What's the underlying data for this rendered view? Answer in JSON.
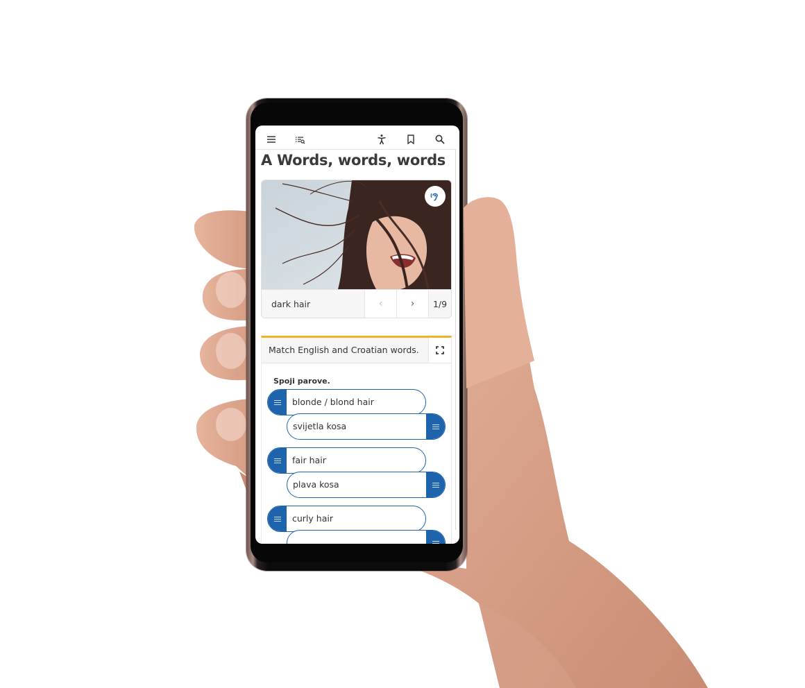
{
  "toolbar": {
    "icons": [
      "menu-icon",
      "table-of-contents-search-icon",
      "accessibility-icon",
      "bookmark-icon",
      "search-icon"
    ]
  },
  "page": {
    "title": "A Words, words, words"
  },
  "gallery": {
    "caption": "dark hair",
    "prev_label": "‹",
    "next_label": "›",
    "counter": "1/9",
    "listen_icon": "hearing-icon"
  },
  "exercise": {
    "title": "Match English and Croatian words.",
    "expand_icon": "fullscreen-icon",
    "instruction": "Spoji parove.",
    "pairs": [
      {
        "english": "blonde / blond hair",
        "croatian": "svijetla kosa"
      },
      {
        "english": "fair hair",
        "croatian": "plava kosa"
      },
      {
        "english": "curly hair",
        "croatian": ""
      }
    ]
  },
  "colors": {
    "accent_blue": "#1e64ad",
    "exercise_border": "#f2b322",
    "text": "#333333"
  }
}
